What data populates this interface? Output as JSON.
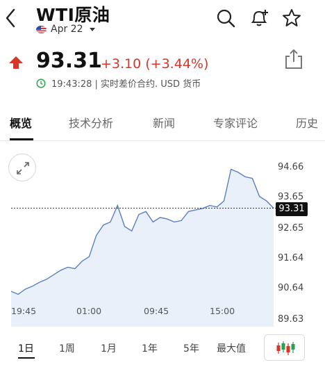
{
  "header": {
    "title": "WTI原油",
    "date": "Apr 22"
  },
  "quote": {
    "price": "93.31",
    "change": "+3.10 (+3.44%)",
    "time_text": "19:43:28 | 实时差价合约. USD 货币"
  },
  "tabs": [
    "概览",
    "技术分析",
    "新闻",
    "专家评论",
    "历史"
  ],
  "chart": {
    "current_price_tag": "93.31",
    "y_ticks": [
      "94.66",
      "93.65",
      "92.65",
      "91.64",
      "90.64",
      "89.63"
    ],
    "x_ticks": [
      "19:45",
      "01:00",
      "09:45",
      "15:00"
    ]
  },
  "chart_data": {
    "type": "area",
    "title": "",
    "xlabel": "",
    "ylabel": "",
    "ylim": [
      89.63,
      94.66
    ],
    "x_ticks": [
      "19:45",
      "01:00",
      "09:45",
      "15:00"
    ],
    "series": [
      {
        "values": [
          90.55,
          90.45,
          90.62,
          90.72,
          90.85,
          90.95,
          91.1,
          91.25,
          91.35,
          91.3,
          91.55,
          91.7,
          92.4,
          92.75,
          92.85,
          93.4,
          92.7,
          92.55,
          93.1,
          93.2,
          92.85,
          93.0,
          92.95,
          92.85,
          92.9,
          93.2,
          93.25,
          93.3,
          93.4,
          93.35,
          93.55,
          94.6,
          94.5,
          94.35,
          94.3,
          93.7,
          93.55,
          93.31
        ]
      }
    ],
    "reference_line": 93.31,
    "grid": false
  },
  "ranges": [
    "1日",
    "1周",
    "1月",
    "1年",
    "5年",
    "最大值"
  ],
  "colors": {
    "up": "#d8352a",
    "line": "#5b7fbf",
    "area": "#e9f0f9"
  }
}
